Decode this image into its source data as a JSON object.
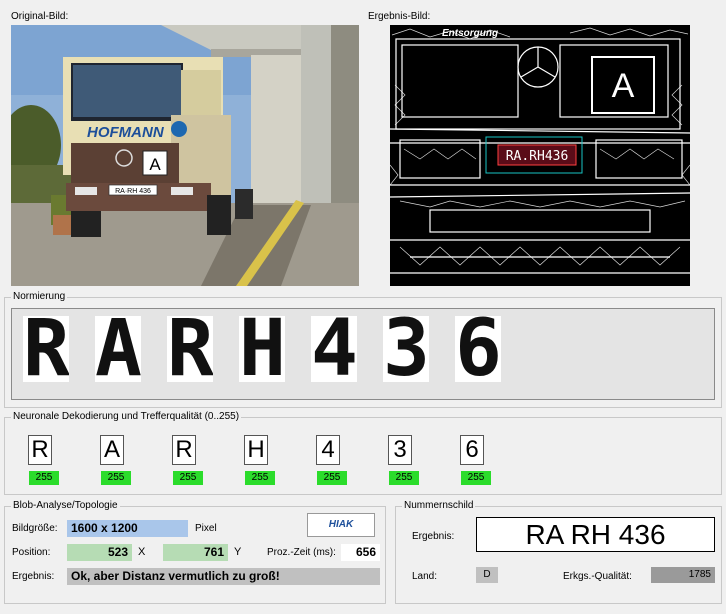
{
  "original_panel": {
    "title": "Original-Bild:"
  },
  "result_panel": {
    "title": "Ergebnis-Bild:",
    "overlay_text": "Entsorgung",
    "plate_overlay": "RA.RH436",
    "badge_letter": "A"
  },
  "truck_photo": {
    "brand_text": "HOFMANN",
    "plate_text": "RA·RH 436",
    "badge_letter": "A"
  },
  "normierung": {
    "title": "Normierung",
    "chars": [
      "R",
      "A",
      "R",
      "H",
      "4",
      "3",
      "6"
    ]
  },
  "decoding": {
    "title": "Neuronale Dekodierung und Trefferqualität (0..255)",
    "chars": [
      "R",
      "A",
      "R",
      "H",
      "4",
      "3",
      "6"
    ],
    "scores": [
      "255",
      "255",
      "255",
      "255",
      "255",
      "255",
      "255"
    ],
    "score_color": "#2bdc2b"
  },
  "blob": {
    "title": "Blob-Analyse/Topologie",
    "size_label": "Bildgröße:",
    "size_value": "1600 x 1200",
    "size_unit": "Pixel",
    "position_label": "Position:",
    "pos_x": "523",
    "x_label": "X",
    "pos_y": "761",
    "y_label": "Y",
    "time_label": "Proz.-Zeit (ms):",
    "time_value": "656",
    "result_label": "Ergebnis:",
    "result_value": "Ok, aber Distanz vermutlich zu groß!",
    "logo_text": "HIAK"
  },
  "plate": {
    "title": "Nummernschild",
    "result_label": "Ergebnis:",
    "result_value": "RA RH 436",
    "country_label": "Land:",
    "country_value": "D",
    "quality_label": "Erkgs.-Qualität:",
    "quality_value": "1785"
  }
}
